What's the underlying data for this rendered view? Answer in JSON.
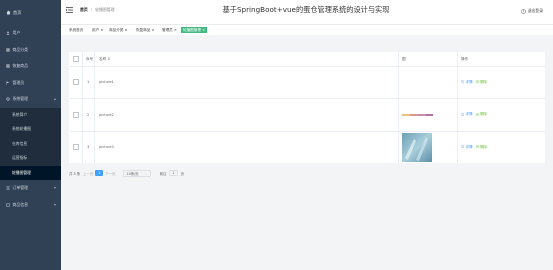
{
  "sidebar": {
    "logo": "首页",
    "items": [
      {
        "label": "用户"
      },
      {
        "label": "商品分类"
      },
      {
        "label": "恢复商品"
      },
      {
        "label": "管理员"
      },
      {
        "label": "系统管理"
      }
    ],
    "sub_items": [
      {
        "label": "系统简介"
      },
      {
        "label": "系统轮播图"
      },
      {
        "label": "仓库信息"
      },
      {
        "label": "运营指标"
      },
      {
        "label": "轮播图管理"
      }
    ],
    "after_items": [
      {
        "label": "订单管理"
      },
      {
        "label": "商品信息"
      }
    ]
  },
  "topbar": {
    "breadcrumb_home": "首页",
    "breadcrumb_sep": "/",
    "breadcrumb_current": "轮播图管理",
    "title": "基于SpringBoot+vue的蛋仓管理系统的设计与实现",
    "logout": "退出登录"
  },
  "tags": [
    "系统首页",
    "用户 ×",
    "商品分类 ×",
    "恢复商品 ×",
    "管理员 ×",
    "轮播图管理 ×"
  ],
  "table": {
    "headers": {
      "index": "序号",
      "name": "名称 ⇕",
      "image": "图",
      "actions": "操作"
    },
    "rows": [
      {
        "index": "1",
        "name": "picture1",
        "detail": "详情",
        "delete": "删除"
      },
      {
        "index": "2",
        "name": "picture2",
        "detail": "详情",
        "delete": "删除"
      },
      {
        "index": "3",
        "name": "picture3",
        "detail": "详情",
        "delete": "删除"
      }
    ]
  },
  "pager": {
    "total": "共 3 条",
    "prev": "上一页",
    "current": "1",
    "next": "下一页",
    "page_size": "10条/页",
    "goto": "前往",
    "goto_value": "1",
    "page_unit": "页"
  },
  "colors": {
    "sidebar": "#304156",
    "accent": "#42b983",
    "link": "#409eff"
  }
}
